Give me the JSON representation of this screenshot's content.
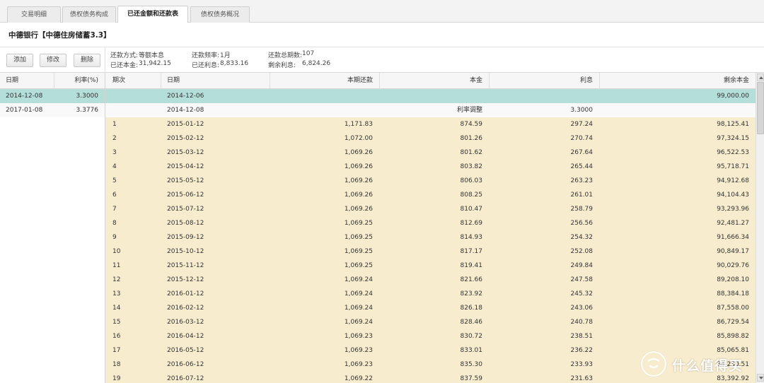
{
  "tabs": [
    {
      "label": "交易明细"
    },
    {
      "label": "债权债务构成"
    },
    {
      "label": "已还金额和还款表"
    },
    {
      "label": "债权债务概况"
    }
  ],
  "page_title": "中德银行【中德住房储蓄3.3】",
  "toolbar": {
    "add_label": "添加",
    "edit_label": "修改",
    "delete_label": "删除"
  },
  "info": {
    "method_label": "还款方式:",
    "method_value": "等额本息",
    "freq_label": "还款频率:",
    "freq_value": "1月",
    "periods_label": "还款总期数:",
    "periods_value": "107",
    "principal_repaid_label": "已还本金:",
    "principal_repaid_value": "31,942.15",
    "interest_repaid_label": "已还利息:",
    "interest_repaid_value": "8,833.16",
    "remaining_interest_label": "剩余利息:",
    "remaining_interest_value": "6,824.26"
  },
  "rate_table": {
    "headers": {
      "date": "日期",
      "rate": "利率(%)"
    },
    "rows": [
      {
        "date": "2014-12-08",
        "rate": "3.3000"
      },
      {
        "date": "2017-01-08",
        "rate": "3.3776"
      }
    ]
  },
  "schedule": {
    "headers": {
      "period": "期次",
      "date": "日期",
      "payment": "本期还款",
      "principal": "本金",
      "interest": "利息",
      "remaining": "剩余本金"
    },
    "rows": [
      {
        "period": "",
        "date": "2014-12-06",
        "payment": "",
        "principal": "",
        "interest": "",
        "remaining": "99,000.00"
      },
      {
        "period": "",
        "date": "2014-12-08",
        "payment": "",
        "principal": "利率调整",
        "interest": "3.3000",
        "remaining": ""
      },
      {
        "period": "1",
        "date": "2015-01-12",
        "payment": "1,171.83",
        "principal": "874.59",
        "interest": "297.24",
        "remaining": "98,125.41"
      },
      {
        "period": "2",
        "date": "2015-02-12",
        "payment": "1,072.00",
        "principal": "801.26",
        "interest": "270.74",
        "remaining": "97,324.15"
      },
      {
        "period": "3",
        "date": "2015-03-12",
        "payment": "1,069.26",
        "principal": "801.62",
        "interest": "267.64",
        "remaining": "96,522.53"
      },
      {
        "period": "4",
        "date": "2015-04-12",
        "payment": "1,069.26",
        "principal": "803.82",
        "interest": "265.44",
        "remaining": "95,718.71"
      },
      {
        "period": "5",
        "date": "2015-05-12",
        "payment": "1,069.26",
        "principal": "806.03",
        "interest": "263.23",
        "remaining": "94,912.68"
      },
      {
        "period": "6",
        "date": "2015-06-12",
        "payment": "1,069.26",
        "principal": "808.25",
        "interest": "261.01",
        "remaining": "94,104.43"
      },
      {
        "period": "7",
        "date": "2015-07-12",
        "payment": "1,069.26",
        "principal": "810.47",
        "interest": "258.79",
        "remaining": "93,293.96"
      },
      {
        "period": "8",
        "date": "2015-08-12",
        "payment": "1,069.25",
        "principal": "812.69",
        "interest": "256.56",
        "remaining": "92,481.27"
      },
      {
        "period": "9",
        "date": "2015-09-12",
        "payment": "1,069.25",
        "principal": "814.93",
        "interest": "254.32",
        "remaining": "91,666.34"
      },
      {
        "period": "10",
        "date": "2015-10-12",
        "payment": "1,069.25",
        "principal": "817.17",
        "interest": "252.08",
        "remaining": "90,849.17"
      },
      {
        "period": "11",
        "date": "2015-11-12",
        "payment": "1,069.25",
        "principal": "819.41",
        "interest": "249.84",
        "remaining": "90,029.76"
      },
      {
        "period": "12",
        "date": "2015-12-12",
        "payment": "1,069.24",
        "principal": "821.66",
        "interest": "247.58",
        "remaining": "89,208.10"
      },
      {
        "period": "13",
        "date": "2016-01-12",
        "payment": "1,069.24",
        "principal": "823.92",
        "interest": "245.32",
        "remaining": "88,384.18"
      },
      {
        "period": "14",
        "date": "2016-02-12",
        "payment": "1,069.24",
        "principal": "826.18",
        "interest": "243.06",
        "remaining": "87,558.00"
      },
      {
        "period": "15",
        "date": "2016-03-12",
        "payment": "1,069.24",
        "principal": "828.46",
        "interest": "240.78",
        "remaining": "86,729.54"
      },
      {
        "period": "16",
        "date": "2016-04-12",
        "payment": "1,069.23",
        "principal": "830.72",
        "interest": "238.51",
        "remaining": "85,898.82"
      },
      {
        "period": "17",
        "date": "2016-05-12",
        "payment": "1,069.23",
        "principal": "833.01",
        "interest": "236.22",
        "remaining": "85,065.81"
      },
      {
        "period": "18",
        "date": "2016-06-12",
        "payment": "1,069.23",
        "principal": "835.30",
        "interest": "233.93",
        "remaining": "84,230.51"
      },
      {
        "period": "19",
        "date": "2016-07-12",
        "payment": "1,069.22",
        "principal": "837.59",
        "interest": "231.63",
        "remaining": "83,392.92"
      }
    ]
  },
  "watermark": {
    "text": "什么值得买"
  },
  "colors": {
    "selected_row": "#b4dfd9",
    "schedule_row": "#f8ecce",
    "plain_row": "#f9f9f9"
  }
}
